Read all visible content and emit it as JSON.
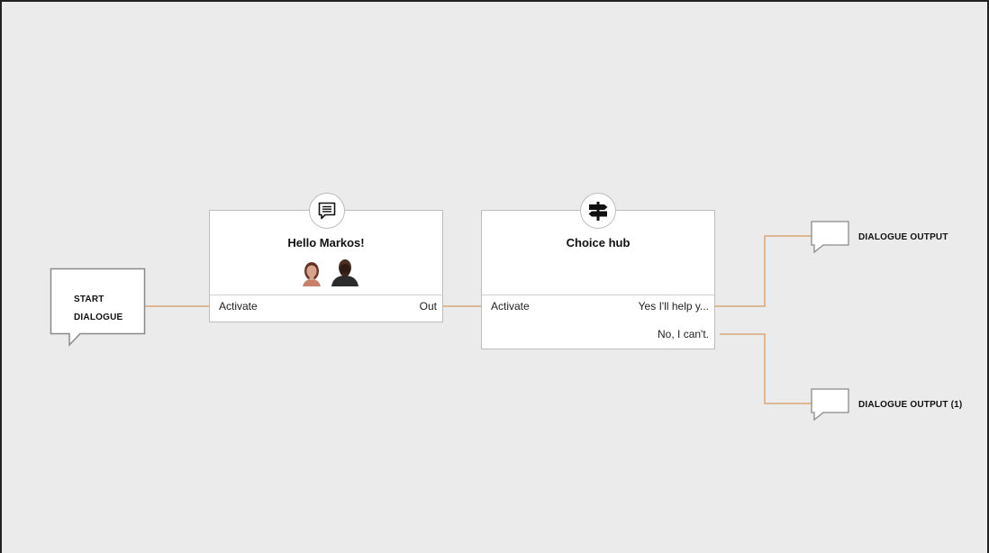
{
  "start_node": {
    "label_line1": "START",
    "label_line2": "DIALOGUE"
  },
  "dialogue_node": {
    "title": "Hello Markos!",
    "input_port": "Activate",
    "output_port": "Out",
    "icon": "speech-bubble-icon",
    "avatars": [
      "woman-portrait",
      "man-portrait"
    ]
  },
  "choice_node": {
    "title": "Choice hub",
    "input_port": "Activate",
    "choices": [
      "Yes I'll help y...",
      "No, I can't."
    ],
    "icon": "signpost-icon"
  },
  "outputs": [
    {
      "label": "DIALOGUE OUTPUT"
    },
    {
      "label": "DIALOGUE OUTPUT (1)"
    }
  ],
  "colors": {
    "wire": "#d9a777",
    "canvas": "#ebebeb",
    "node_border": "#bdbdbd"
  }
}
